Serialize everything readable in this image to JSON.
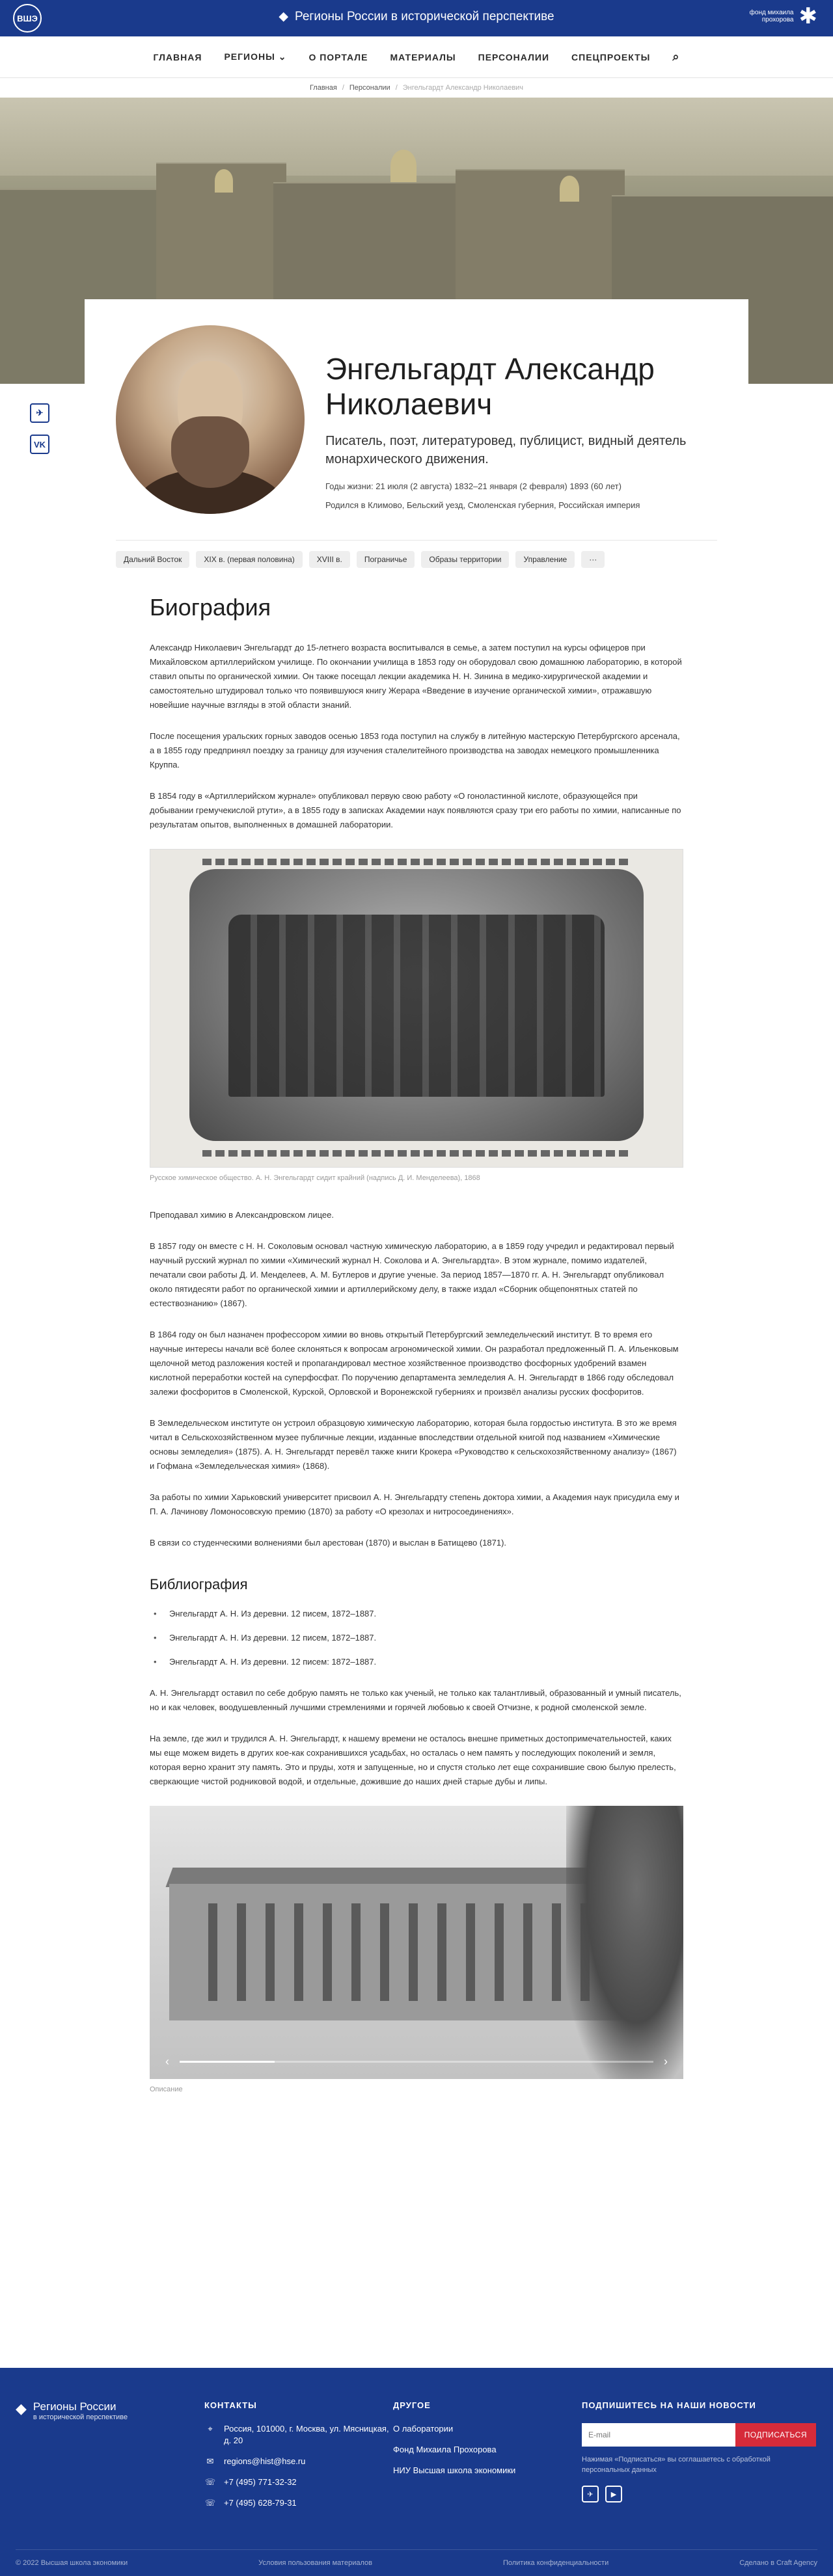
{
  "header": {
    "hse_logo": "ВШЭ",
    "brand": "Регионы России в исторической перспективе",
    "fund": "фонд михаила прохорова"
  },
  "nav": {
    "items": [
      "ГЛАВНАЯ",
      "РЕГИОНЫ",
      "О ПОРТАЛЕ",
      "МАТЕРИАЛЫ",
      "ПЕРСОНАЛИИ",
      "СПЕЦПРОЕКТЫ"
    ]
  },
  "breadcrumbs": {
    "home": "Главная",
    "section": "Персоналии",
    "current": "Энгельгардт Александр Николаевич"
  },
  "share": {
    "telegram": "✈",
    "vk": "VK"
  },
  "person": {
    "name": "Энгельгардт Александр Николаевич",
    "role": "Писатель, поэт, литературовед, публицист, видный деятель монархического движения.",
    "years": "Годы жизни: 21 июля (2 августа) 1832–21 января (2 февраля) 1893 (60 лет)",
    "born": "Родился в Климово, Бельский уезд, Смоленская губерния, Российская империя"
  },
  "tags": [
    "Дальний Восток",
    "XIX в. (первая половина)",
    "XVIII в.",
    "Пограничье",
    "Образы территории",
    "Управление",
    "···"
  ],
  "bio": {
    "title": "Биография",
    "p1": "Александр Николаевич Энгельгардт до 15-летнего возраста воспитывался в семье, а затем поступил на курсы офицеров при Михайловском артиллерийском училище. По окончании училища в 1853 году он оборудовал свою домашнюю лабораторию, в которой ставил опыты по органической химии. Он также посещал лекции академика Н. Н. Зинина в медико-хирургической академии и самостоятельно штудировал только что появившуюся книгу Жерара «Введение в изучение органической химии», отражавшую новейшие научные взгляды в этой области знаний.",
    "p2": "После посещения уральских горных заводов осенью 1853 года поступил на службу в литейную мастерскую Петербургского арсенала, а в 1855 году предпринял поездку за границу для изучения сталелитейного производства на заводах немецкого промышленника Круппа.",
    "p3": "В 1854 году в «Артиллерийском журнале» опубликовал первую свою работу «О гоноластинной кислоте, образующейся при добывании гремучекислой ртути», а в 1855 году в записках Академии наук появляются сразу три его работы по химии, написанные по результатам опытов, выполненных в домашней лаборатории.",
    "caption1": "Русское химическое общество. А. Н. Энгельгардт сидит крайний (надпись Д. И. Менделеева), 1868",
    "p4": "Преподавал химию в Александровском лицее.",
    "p5": "В 1857 году он вместе с Н. Н. Соколовым основал частную химическую лабораторию, а в 1859 году учредил и редактировал первый научный русский журнал по химии «Химический журнал Н. Соколова и А. Энгельгардта». В этом журнале, помимо издателей, печатали свои работы Д. И. Менделеев, А. М. Бутлеров и другие ученые. За период 1857—1870 гг. А. Н. Энгельгардт опубликовал около пятидесяти работ по органической химии и артиллерийскому делу, в также издал «Сборник общепонятных статей по естествознанию» (1867).",
    "p6": "В 1864 году он был назначен профессором химии во вновь открытый Петербургский земледельческий институт. В то время его научные интересы начали всё более склоняться к вопросам агрономической химии. Он разработал предложенный П. А. Ильенковым щелочной метод разложения костей и пропагандировал местное хозяйственное производство фосфорных удобрений взамен кислотной переработки костей на суперфосфат. По поручению департамента земледелия А. Н. Энгельгардт в 1866 году обследовал залежи фосфоритов в Смоленской, Курской, Орловской и Воронежской губерниях и произвёл анализы русских фосфоритов.",
    "p7": "В Земледельческом институте он устроил образцовую химическую лабораторию, которая была гордостью института. В это же время читал в Сельскохозяйственном музее публичные лекции, изданные впоследствии отдельной книгой под названием «Химические основы земледелия» (1875). А. Н. Энгельгардт перевёл также книги Крокера «Руководство к сельскохозяйственному анализу» (1867) и Гофмана «Земледельческая химия» (1868).",
    "p8": "За работы по химии Харьковский университет присвоил А. Н. Энгельгардту степень доктора химии, а Академия наук присудила ему и П. А. Лачинову Ломоносовскую премию (1870) за работу «О крезолах и нитросоединениях».",
    "p9": "В связи со студенческими волнениями был арестован (1870) и выслан в Батищево (1871)."
  },
  "biblio": {
    "title": "Библиография",
    "items": [
      "Энгельгардт А. Н. Из деревни. 12 писем, 1872–1887.",
      "Энгельгардт А. Н. Из деревни. 12 писем, 1872–1887.",
      "Энгельгардт А. Н. Из деревни. 12 писем: 1872–1887."
    ]
  },
  "after": {
    "p1": "А. Н. Энгельгардт оставил по себе добрую память не только как ученый, не только как талантливый, образованный и умный писатель, но и как человек, воодушевленный лучшими стремлениями и горячей любовью к своей Отчизне, к родной смоленской земле.",
    "p2": "На земле, где жил и трудился А. Н. Энгельгардт, к нашему времени не осталось внешне приметных достопримечательностей, каких мы еще можем видеть в других кое-как сохранившихся усадьбах, но осталась о нем память у последующих поколений и земля, которая верно хранит эту память. Это и пруды, хотя и запущенные, но и спустя столько лет еще сохранившие свою былую прелесть, сверкающие чистой родниковой водой, и отдельные, дожившие до наших дней старые дубы и липы.",
    "caption2": "Описание",
    "slider_progress": 0.2
  },
  "footer": {
    "brand1": "Регионы России",
    "brand2": "в исторической перспективе",
    "contacts_title": "КОНТАКТЫ",
    "address": "Россия, 101000, г. Москва, ул. Мясницкая, д. 20",
    "email": "regions@hist@hse.ru",
    "phone1": "+7 (495) 771-32-32",
    "phone2": "+7 (495) 628-79-31",
    "other_title": "ДРУГОЕ",
    "other": [
      "О лаборатории",
      "Фонд Михаила Прохорова",
      "НИУ Высшая школа экономики"
    ],
    "sub_title": "ПОДПИШИТЕСЬ НА НАШИ НОВОСТИ",
    "email_placeholder": "E-mail",
    "sub_button": "ПОДПИСАТЬСЯ",
    "sub_note": "Нажимая «Подписаться» вы соглашаетесь с обработкой персональных данных",
    "copyright": "© 2022 Высшая школа экономики",
    "terms": "Условия пользования материалов",
    "privacy": "Политика конфиденциальности",
    "made": "Сделано в Craft Agency"
  }
}
